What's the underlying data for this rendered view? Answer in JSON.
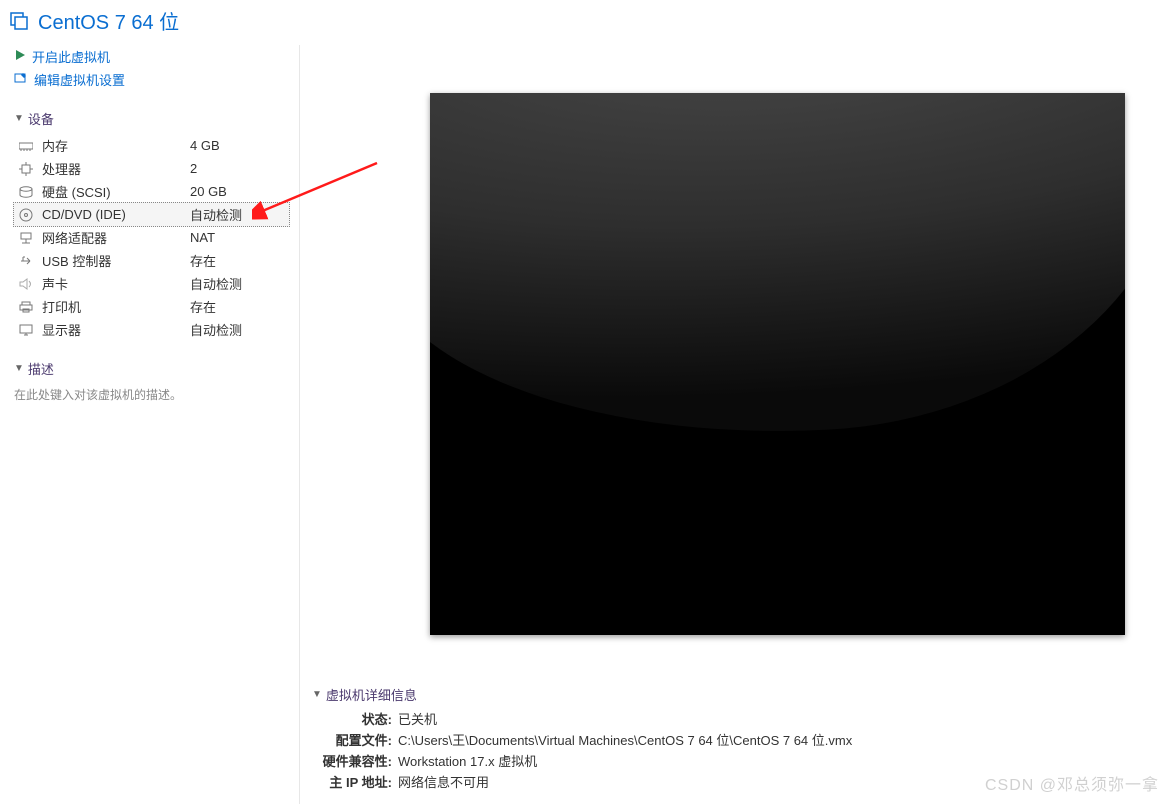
{
  "header": {
    "title": "CentOS 7 64 位"
  },
  "actions": {
    "power_on": "开启此虚拟机",
    "edit_settings": "编辑虚拟机设置"
  },
  "sections": {
    "devices": "设备",
    "description": "描述",
    "details": "虚拟机详细信息"
  },
  "devices": [
    {
      "icon": "memory-icon",
      "name": "内存",
      "value": "4 GB"
    },
    {
      "icon": "cpu-icon",
      "name": "处理器",
      "value": "2"
    },
    {
      "icon": "disk-icon",
      "name": "硬盘 (SCSI)",
      "value": "20 GB"
    },
    {
      "icon": "cd-icon",
      "name": "CD/DVD (IDE)",
      "value": "自动检测",
      "selected": true
    },
    {
      "icon": "network-icon",
      "name": "网络适配器",
      "value": "NAT"
    },
    {
      "icon": "usb-icon",
      "name": "USB 控制器",
      "value": "存在"
    },
    {
      "icon": "sound-icon",
      "name": "声卡",
      "value": "自动检测"
    },
    {
      "icon": "printer-icon",
      "name": "打印机",
      "value": "存在"
    },
    {
      "icon": "display-icon",
      "name": "显示器",
      "value": "自动检测"
    }
  ],
  "description_placeholder": "在此处键入对该虚拟机的描述。",
  "details": {
    "state_k": "状态:",
    "state_v": "已关机",
    "config_k": "配置文件:",
    "config_v": "C:\\Users\\王\\Documents\\Virtual Machines\\CentOS 7 64 位\\CentOS 7 64 位.vmx",
    "compat_k": "硬件兼容性:",
    "compat_v": "Workstation 17.x 虚拟机",
    "ip_k": "主 IP 地址:",
    "ip_v": "网络信息不可用"
  },
  "watermark": "CSDN @邓总须弥一拿"
}
